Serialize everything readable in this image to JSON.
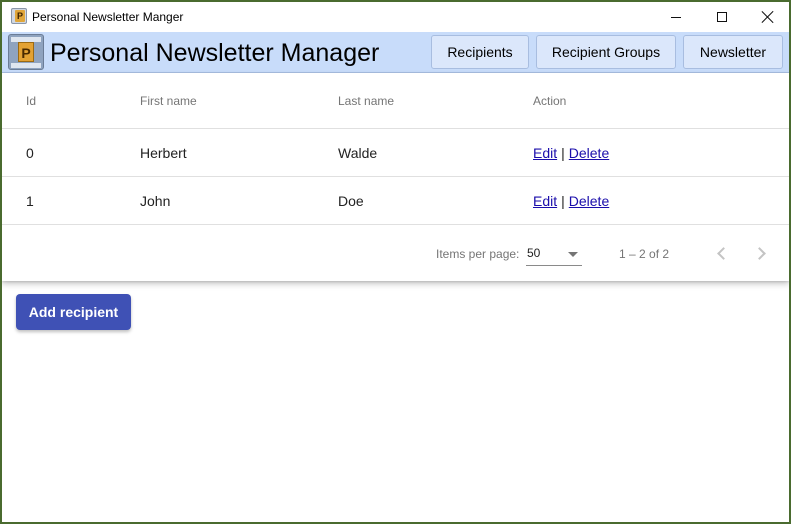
{
  "window": {
    "title": "Personal Newsletter Manger",
    "controls": {
      "minimize": "minimize-icon",
      "maximize": "maximize-icon",
      "close": "close-icon"
    }
  },
  "header": {
    "logo_icon": "app-logo-icon",
    "title": "Personal Newsletter Manager",
    "nav": {
      "recipients": "Recipients",
      "recipient_groups": "Recipient Groups",
      "newsletter": "Newsletter"
    },
    "background": "#c8dcfa"
  },
  "table": {
    "columns": {
      "id": "Id",
      "first_name": "First name",
      "last_name": "Last name",
      "action": "Action"
    },
    "rows": [
      {
        "id": "0",
        "first_name": "Herbert",
        "last_name": "Walde",
        "edit": "Edit",
        "separator": "|",
        "delete": "Delete"
      },
      {
        "id": "1",
        "first_name": "John",
        "last_name": "Doe",
        "edit": "Edit",
        "separator": "|",
        "delete": "Delete"
      }
    ]
  },
  "paginator": {
    "items_per_page_label": "Items per page:",
    "items_per_page_value": "50",
    "range": "1 – 2 of 2",
    "prev_icon": "chevron-left-icon",
    "next_icon": "chevron-right-icon"
  },
  "actions": {
    "add_recipient": "Add recipient",
    "primary_color": "#3f51b5"
  }
}
